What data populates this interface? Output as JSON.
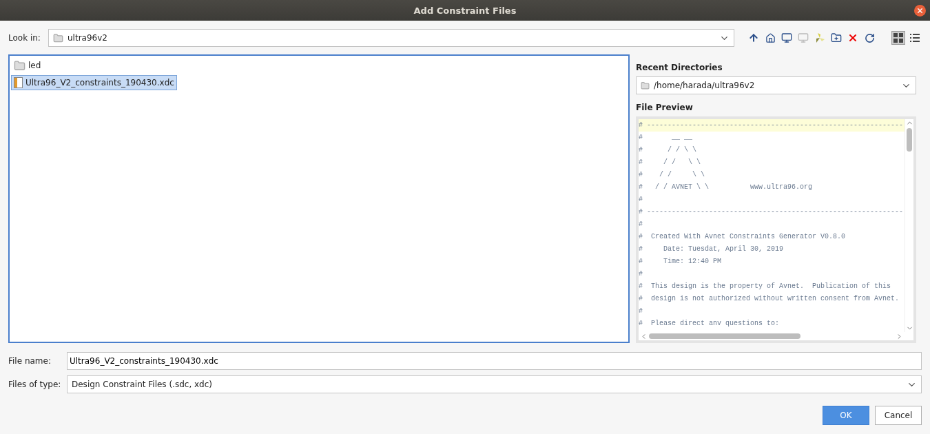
{
  "window": {
    "title": "Add Constraint Files"
  },
  "look_in": {
    "label": "Look in:",
    "value": "ultra96v2"
  },
  "view_mode": {
    "options": [
      {
        "kind": "icons",
        "selected": true
      },
      {
        "kind": "list",
        "selected": false
      }
    ]
  },
  "files": [
    {
      "kind": "folder",
      "name": "led",
      "selected": false
    },
    {
      "kind": "xdc",
      "name": "Ultra96_V2_constraints_190430.xdc",
      "selected": true
    }
  ],
  "recent_directories": {
    "label": "Recent Directories",
    "value": "/home/harada/ultra96v2"
  },
  "file_preview": {
    "label": "File Preview",
    "lines": [
      "# --------------------------------------------------------------",
      "#       __ __",
      "#      / / \\ \\",
      "#     / /   \\ \\",
      "#    / /     \\ \\",
      "#   / / AVNET \\ \\          www.ultra96.org",
      "#",
      "# --------------------------------------------------------------",
      "#",
      "#  Created With Avnet Constraints Generator V0.8.0",
      "#     Date: Tuesdat, April 30, 2019",
      "#     Time: 12:40 PM",
      "#",
      "#  This design is the property of Avnet.  Publication of this",
      "#  design is not authorized without written consent from Avnet.",
      "#",
      "#  Please direct anv questions to:"
    ]
  },
  "file_name": {
    "label": "File name:",
    "value": "Ultra96_V2_constraints_190430.xdc"
  },
  "files_of_type": {
    "label": "Files of type:",
    "value": "Design Constraint Files (.sdc, xdc)"
  },
  "buttons": [
    {
      "label": "OK",
      "kind": "primary"
    },
    {
      "label": "Cancel",
      "kind": "secondary"
    }
  ]
}
